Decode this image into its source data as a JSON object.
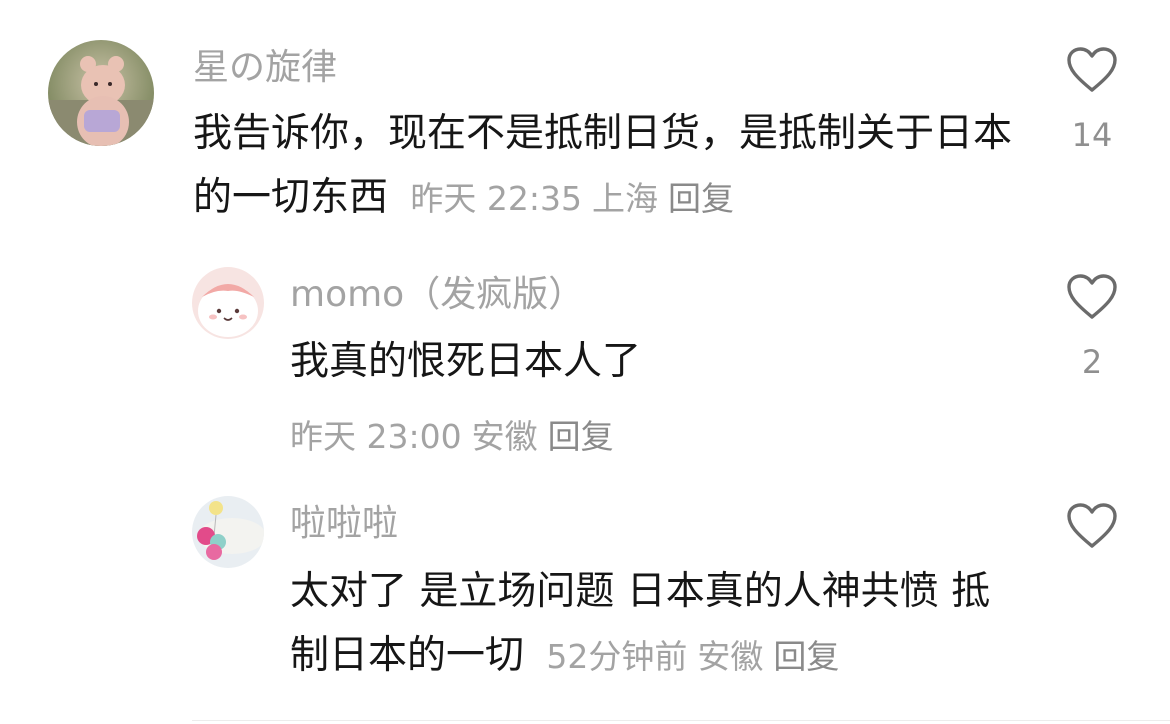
{
  "comments": [
    {
      "username": "星の旋律",
      "text": "我告诉你，现在不是抵制日货，是抵制关于日本的一切东西",
      "time": "昨天 22:35",
      "location": "上海",
      "reply_label": "回复",
      "likes": "14",
      "avatar_icon": "plush-bear-photo"
    },
    {
      "username": "momo（发疯版）",
      "text": "我真的恨死日本人了",
      "time": "昨天 23:00",
      "location": "安徽",
      "reply_label": "回复",
      "likes": "2",
      "avatar_icon": "cute-blob-character"
    },
    {
      "username": "啦啦啦",
      "text": "太对了  是立场问题  日本真的人神共愤  抵制日本的一切",
      "time": "52分钟前",
      "location": "安徽",
      "reply_label": "回复",
      "likes": "",
      "avatar_icon": "balloons-picture"
    }
  ],
  "colors": {
    "meta_gray": "#a3a3a3",
    "text": "#161616",
    "heart_stroke": "#6b6b6b"
  }
}
